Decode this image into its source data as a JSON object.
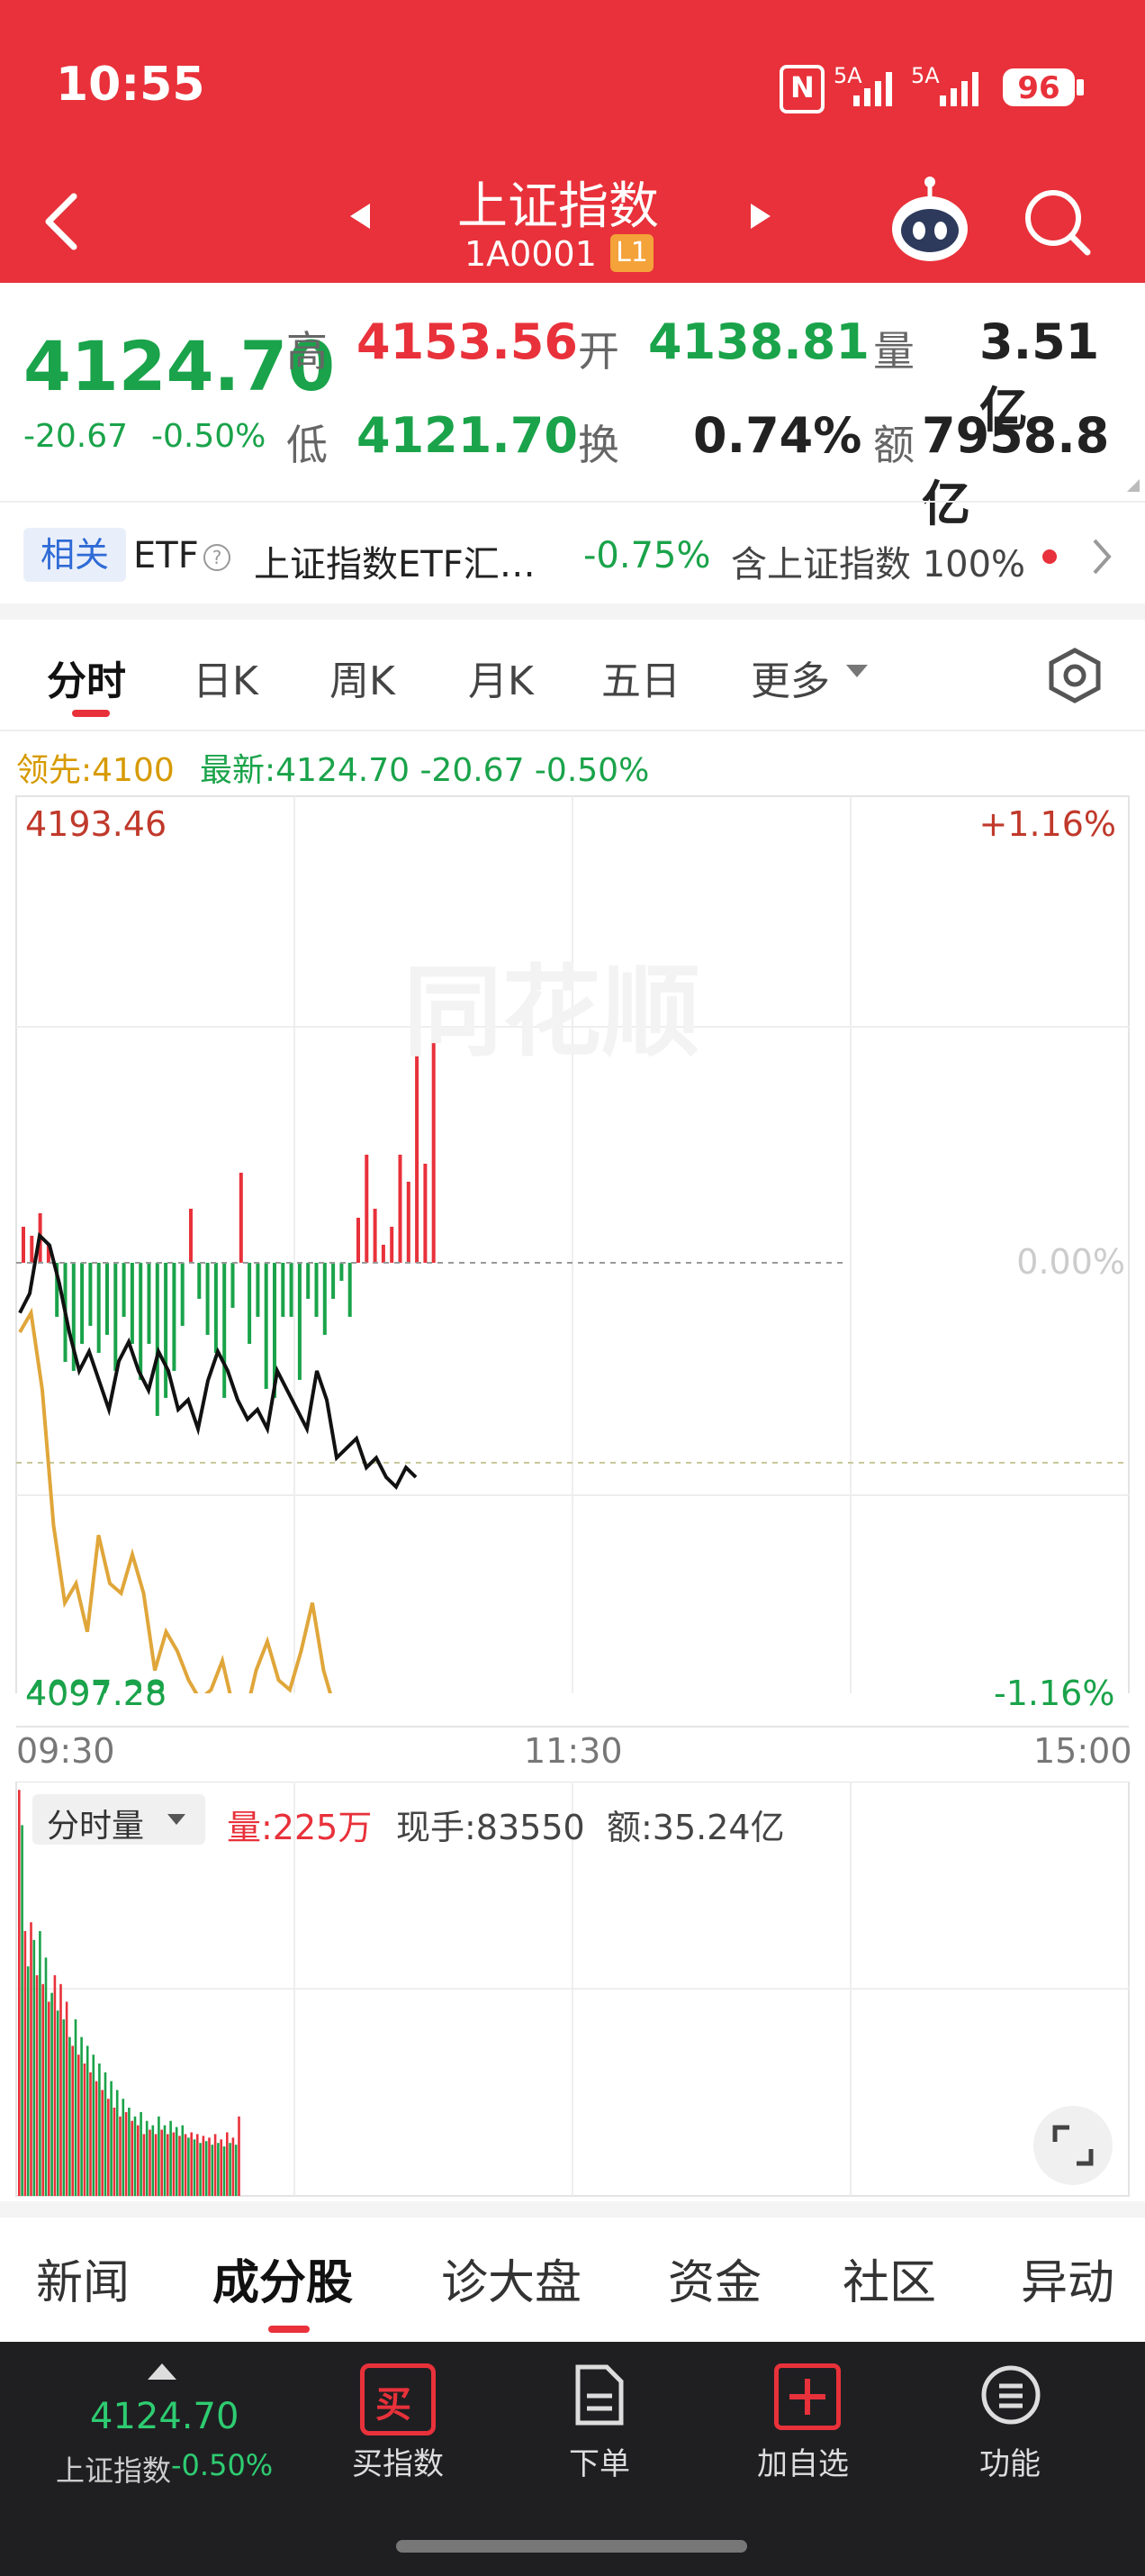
{
  "status": {
    "time": "10:55",
    "net1": "5A",
    "net2": "5A",
    "battery": "96"
  },
  "nav": {
    "title": "上证指数",
    "code": "1A0001",
    "level": "L1"
  },
  "quote": {
    "price": "4124.70",
    "change": "-20.67",
    "change_pct": "-0.50%",
    "high_label": "高",
    "high": "4153.56",
    "open_label": "开",
    "open": "4138.81",
    "vol_label": "量",
    "vol": "3.51亿",
    "low_label": "低",
    "low": "4121.70",
    "turnover_label": "换",
    "turnover": "0.74%",
    "amount_label": "额",
    "amount": "7958.8亿"
  },
  "etf": {
    "tag": "相关",
    "type": "ETF",
    "name": "上证指数ETF汇…",
    "change": "-0.75%",
    "holding": "含上证指数 100%"
  },
  "chart_tabs": [
    "分时",
    "日K",
    "周K",
    "月K",
    "五日",
    "更多"
  ],
  "legend": {
    "lead": "领先:4100",
    "latest": "最新:4124.70  -20.67  -0.50%"
  },
  "axis": {
    "top": "4193.46",
    "bottom": "4097.28",
    "top_pct": "+1.16%",
    "bottom_pct": "-1.16%",
    "mid_pct": "0.00%",
    "time_start": "09:30",
    "time_mid": "11:30",
    "time_end": "15:00"
  },
  "volume": {
    "tab": "分时量",
    "amount": "量:225万",
    "hand": "现手:83550",
    "money": "额:35.24亿"
  },
  "bottom_tabs": [
    "新闻",
    "成分股",
    "诊大盘",
    "资金",
    "社区",
    "异动"
  ],
  "bottom_bar": {
    "price": "4124.70",
    "name": "上证指数",
    "pct": "-0.50%",
    "buy": "买指数",
    "order": "下单",
    "add": "加自选",
    "func": "功能"
  },
  "watermark": "同花顺",
  "colors": {
    "accent": "#e8313a",
    "up": "#e8313a",
    "down": "#1aa34a",
    "lead": "#d79a00"
  },
  "chart_data": {
    "type": "line",
    "ylim": [
      4097.28,
      4193.46
    ],
    "prev_close": 4145.37,
    "series": [
      {
        "y": [
          4140,
          4142,
          4148,
          4147,
          4143,
          4138,
          4134,
          4136,
          4133,
          4130,
          4135,
          4137,
          4134,
          4132,
          4136,
          4134,
          4130,
          4131,
          4128,
          4133,
          4136,
          4134,
          4131,
          4129,
          4130,
          4128,
          4134,
          4132,
          4130,
          4128,
          4134,
          4131,
          4125,
          4126,
          4127,
          4124,
          4125,
          4123,
          4122,
          4124,
          4123
        ]
      },
      {
        "y": [
          4138,
          4140,
          4132,
          4118,
          4110,
          4112,
          4107,
          4117,
          4112,
          4111,
          4115,
          4111,
          4103,
          4107,
          4105,
          4102,
          4100,
          4101,
          4104,
          4099,
          4098,
          4103,
          4106,
          4102,
          4101,
          4105,
          4110,
          4103,
          4099,
          4098,
          4100,
          4098,
          4097,
          4099,
          4098,
          4099
        ]
      }
    ]
  }
}
